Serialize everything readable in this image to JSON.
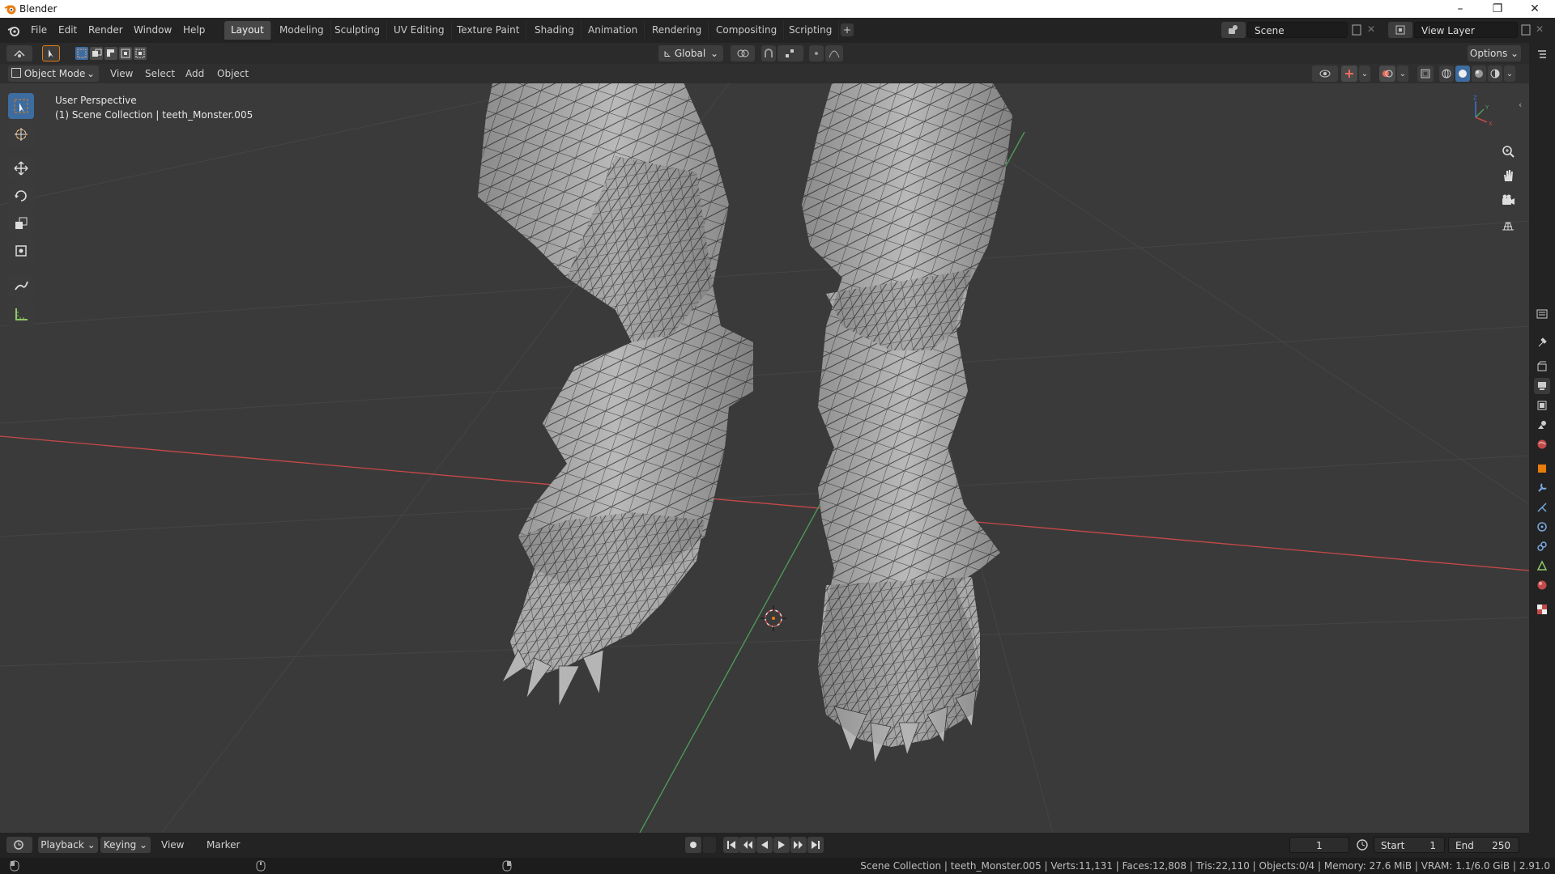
{
  "window": {
    "title": "Blender"
  },
  "menu": [
    "File",
    "Edit",
    "Render",
    "Window",
    "Help"
  ],
  "workspaces": [
    "Layout",
    "Modeling",
    "Sculpting",
    "UV Editing",
    "Texture Paint",
    "Shading",
    "Animation",
    "Rendering",
    "Compositing",
    "Scripting"
  ],
  "active_workspace": "Layout",
  "scene": {
    "name": "Scene"
  },
  "view_layer": {
    "name": "View Layer"
  },
  "transform": {
    "orientation": "Global"
  },
  "options_label": "Options",
  "viewport_menu": {
    "mode": "Object Mode",
    "view": "View",
    "select": "Select",
    "add": "Add",
    "object": "Object"
  },
  "viewport_info": {
    "perspective": "User Perspective",
    "collection": "(1) Scene Collection | teeth_Monster.005"
  },
  "axis_labels": {
    "z": "Z",
    "y": "Y",
    "x": "X"
  },
  "timeline": {
    "playback": "Playback",
    "keying": "Keying",
    "view": "View",
    "marker": "Marker",
    "current_frame": "1",
    "start_label": "Start",
    "start_value": "1",
    "end_label": "End",
    "end_value": "250"
  },
  "status": {
    "text": "Scene Collection | teeth_Monster.005 | Verts:11,131 | Faces:12,808 | Tris:22,110 | Objects:0/4 | Memory: 27.6 MiB | VRAM: 1.1/6.0 GiB | 2.91.0"
  },
  "colors": {
    "accent_orange": "#e87d0d",
    "x_axis": "#d14a4a",
    "y_axis": "#5fa35f",
    "active_tool": "#3d6ca0"
  }
}
